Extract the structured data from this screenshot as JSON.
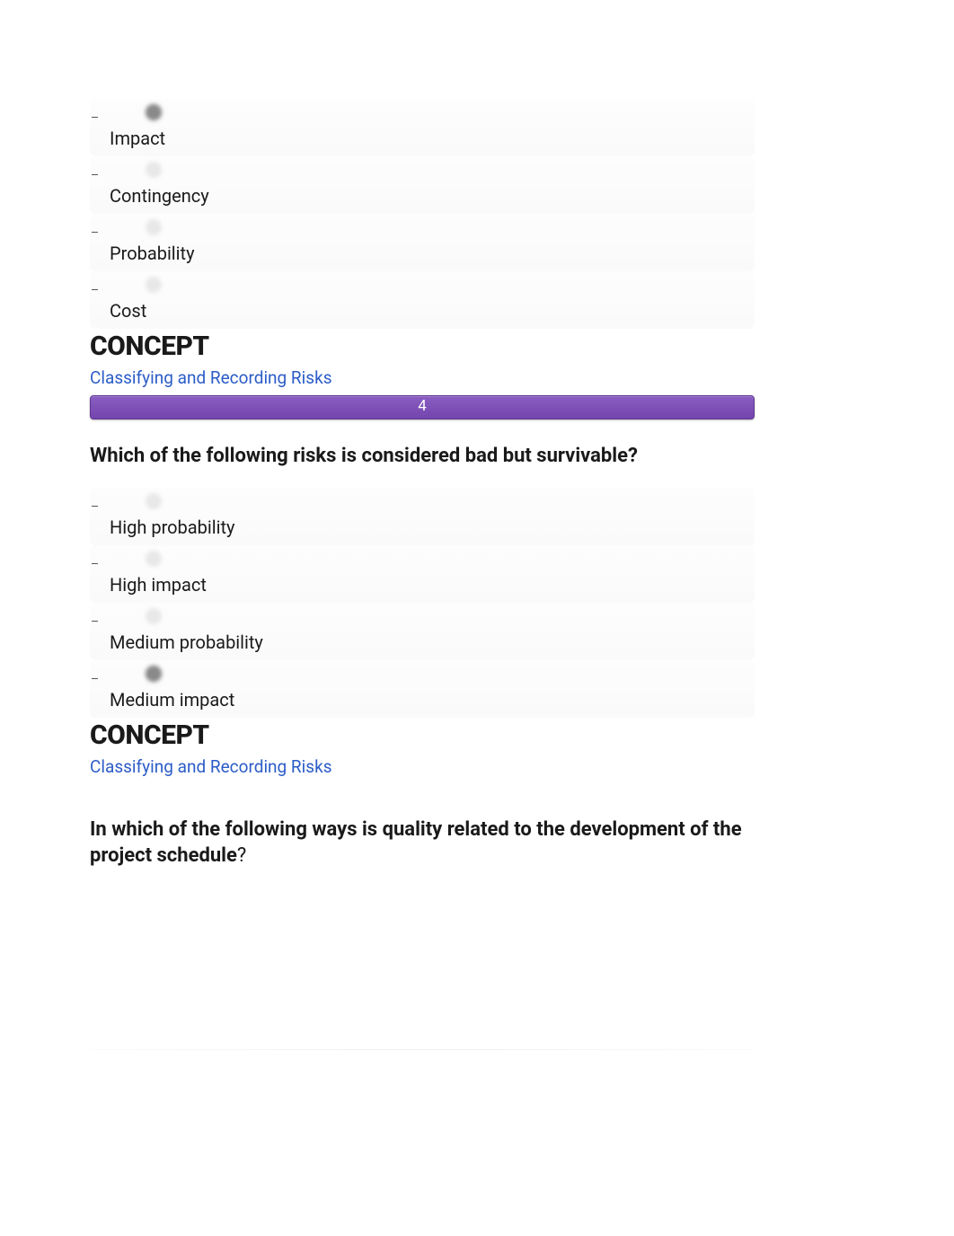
{
  "question1": {
    "options": [
      {
        "label": "Impact",
        "selected": true
      },
      {
        "label": "Contingency",
        "selected": false
      },
      {
        "label": "Probability",
        "selected": false
      },
      {
        "label": "Cost",
        "selected": false
      }
    ],
    "concept_heading": "CONCEPT",
    "concept_link": "Classifying and Recording Risks",
    "divider_number": "4"
  },
  "question2": {
    "prompt": "Which of the following risks is considered bad but survivable?",
    "options": [
      {
        "label": "High probability",
        "selected": false
      },
      {
        "label": "High impact",
        "selected": false
      },
      {
        "label": "Medium probability",
        "selected": false
      },
      {
        "label": "Medium impact",
        "selected": true
      }
    ],
    "concept_heading": "CONCEPT",
    "concept_link": "Classifying and Recording Risks"
  },
  "question3": {
    "prompt_bold": "In which of the following ways is quality related to the development of the project schedule",
    "prompt_tail": "?"
  }
}
